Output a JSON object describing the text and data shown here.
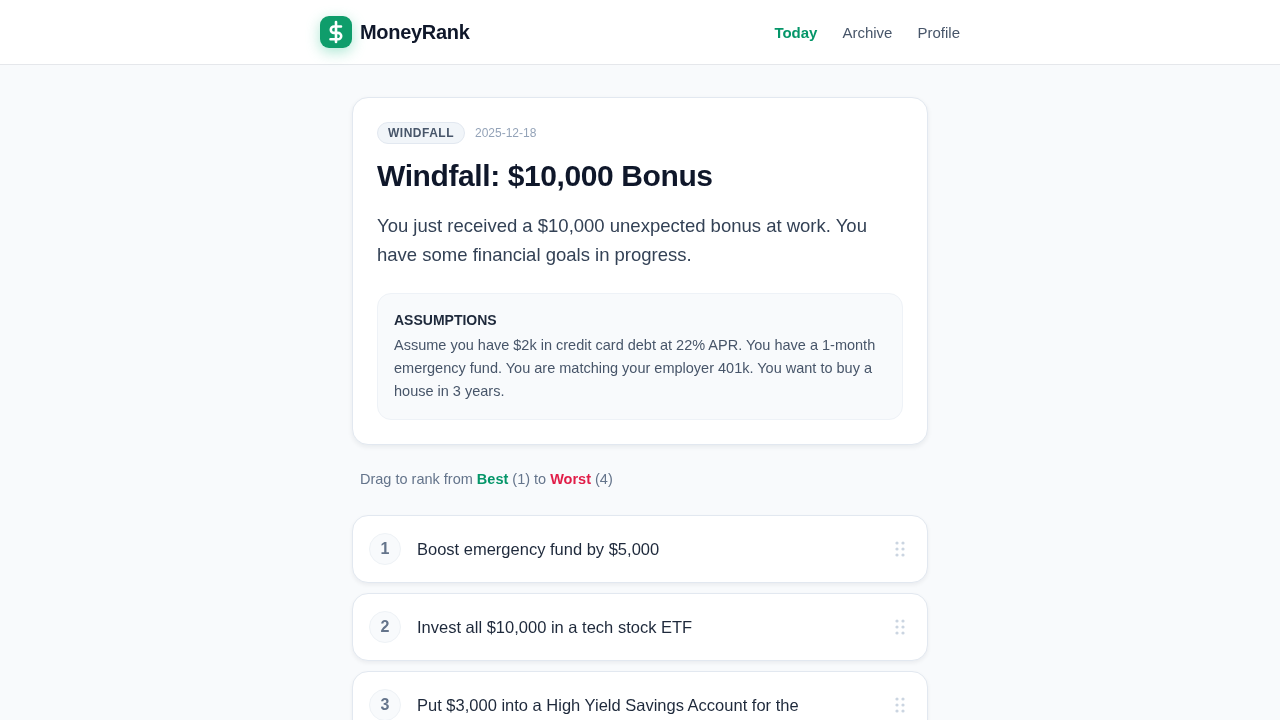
{
  "header": {
    "brand": "MoneyRank",
    "nav": [
      {
        "label": "Today",
        "selected": true
      },
      {
        "label": "Archive",
        "selected": false
      },
      {
        "label": "Profile",
        "selected": false
      }
    ]
  },
  "scenario": {
    "category": "WINDFALL",
    "date": "2025-12-18",
    "title": "Windfall: $10,000 Bonus",
    "description": "You just received a $10,000 unexpected bonus at work. You have some financial goals in progress.",
    "assumptions": {
      "heading": "ASSUMPTIONS",
      "text": "Assume you have $2k in credit card debt at 22% APR. You have a 1-month emergency fund. You are matching your employer 401k. You want to buy a house in 3 years."
    }
  },
  "instruction": "Drag to rank from **Best** (1) to **Worst** (4)",
  "options": [
    {
      "rank": "1",
      "text": "Boost emergency fund by $5,000"
    },
    {
      "rank": "2",
      "text": "Invest all $10,000 in a tech stock ETF"
    },
    {
      "rank": "3",
      "text": "Put $3,000 into a High Yield Savings Account for the"
    }
  ]
}
